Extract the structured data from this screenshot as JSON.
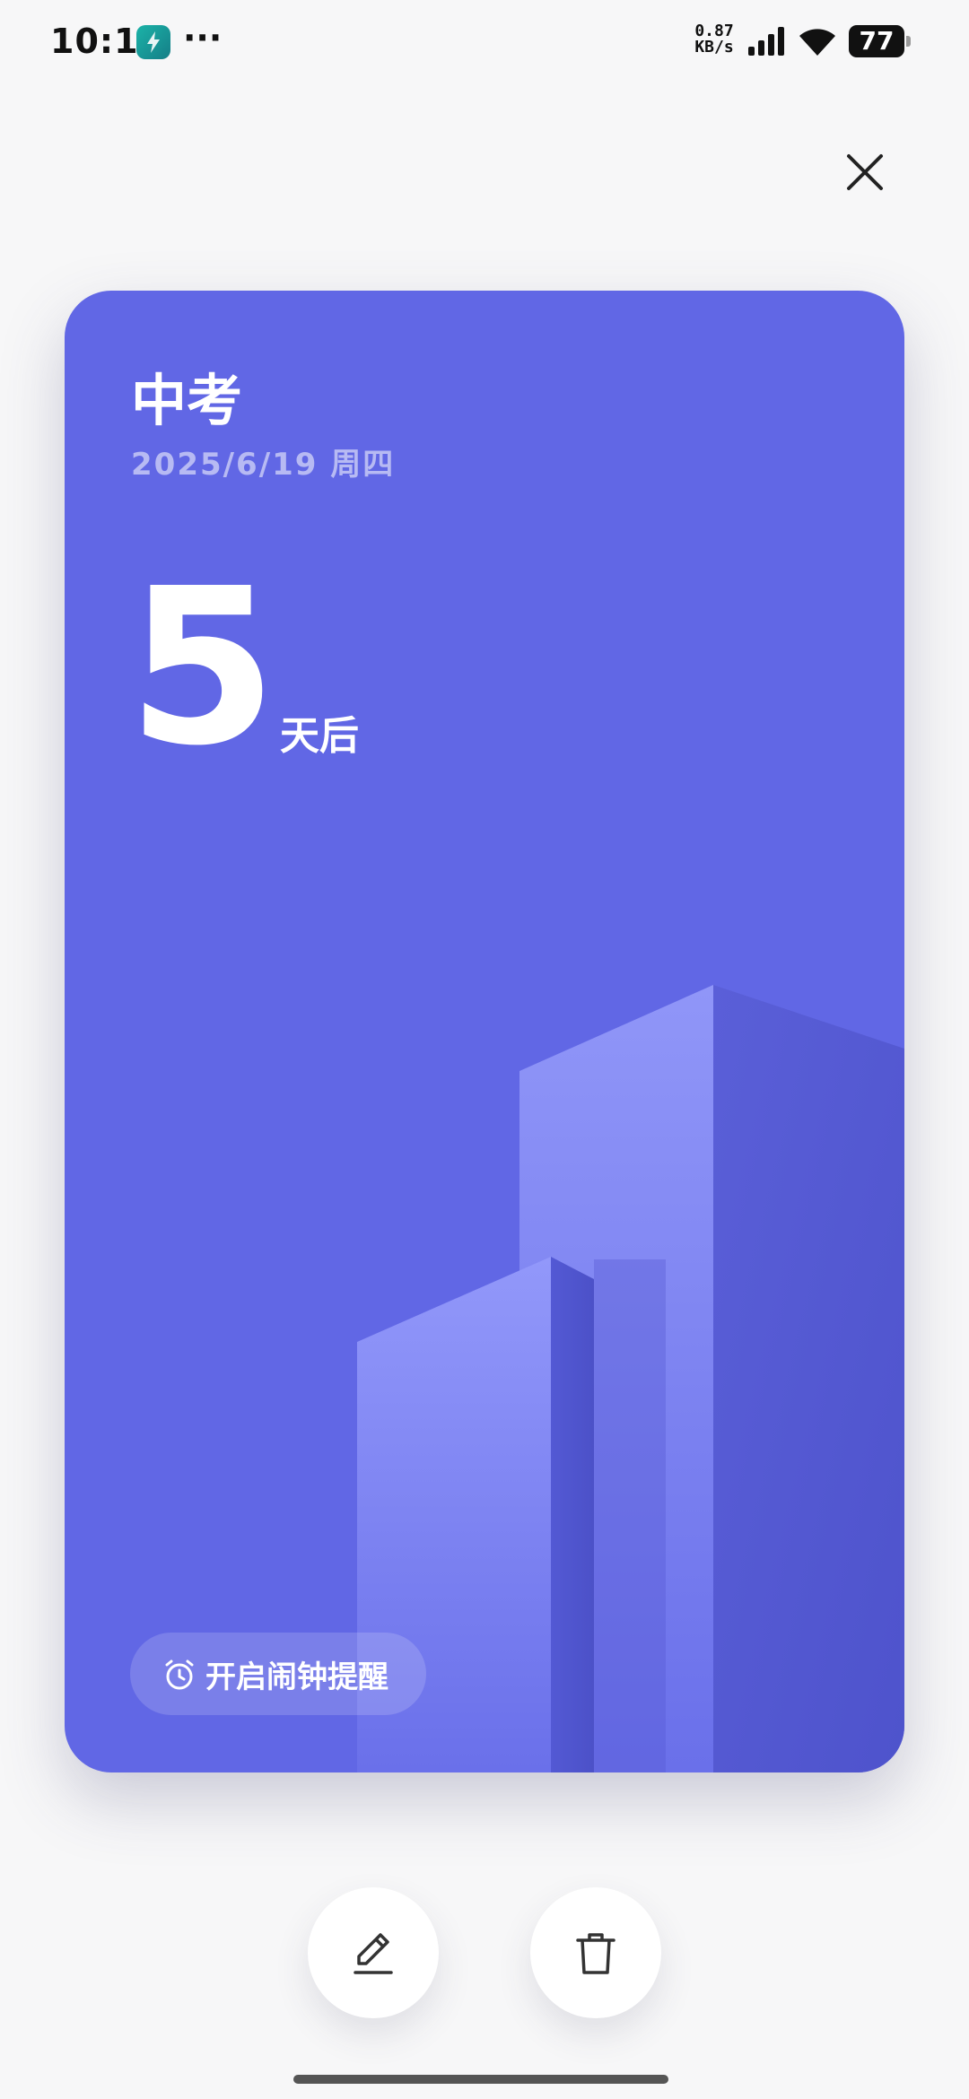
{
  "status_bar": {
    "time": "10:11",
    "more": "···",
    "net_speed_value": "0.87",
    "net_speed_unit": "KB/s",
    "battery": "77"
  },
  "card": {
    "title": "中考",
    "date": "2025/6/19 周四",
    "days": "5",
    "days_suffix": "天后",
    "alarm_label": "开启闹钟提醒",
    "background_color": "#6167e5"
  },
  "icons": {
    "close": "close-icon",
    "edit": "pencil-icon",
    "delete": "trash-icon",
    "alarm": "alarm-clock-icon"
  }
}
